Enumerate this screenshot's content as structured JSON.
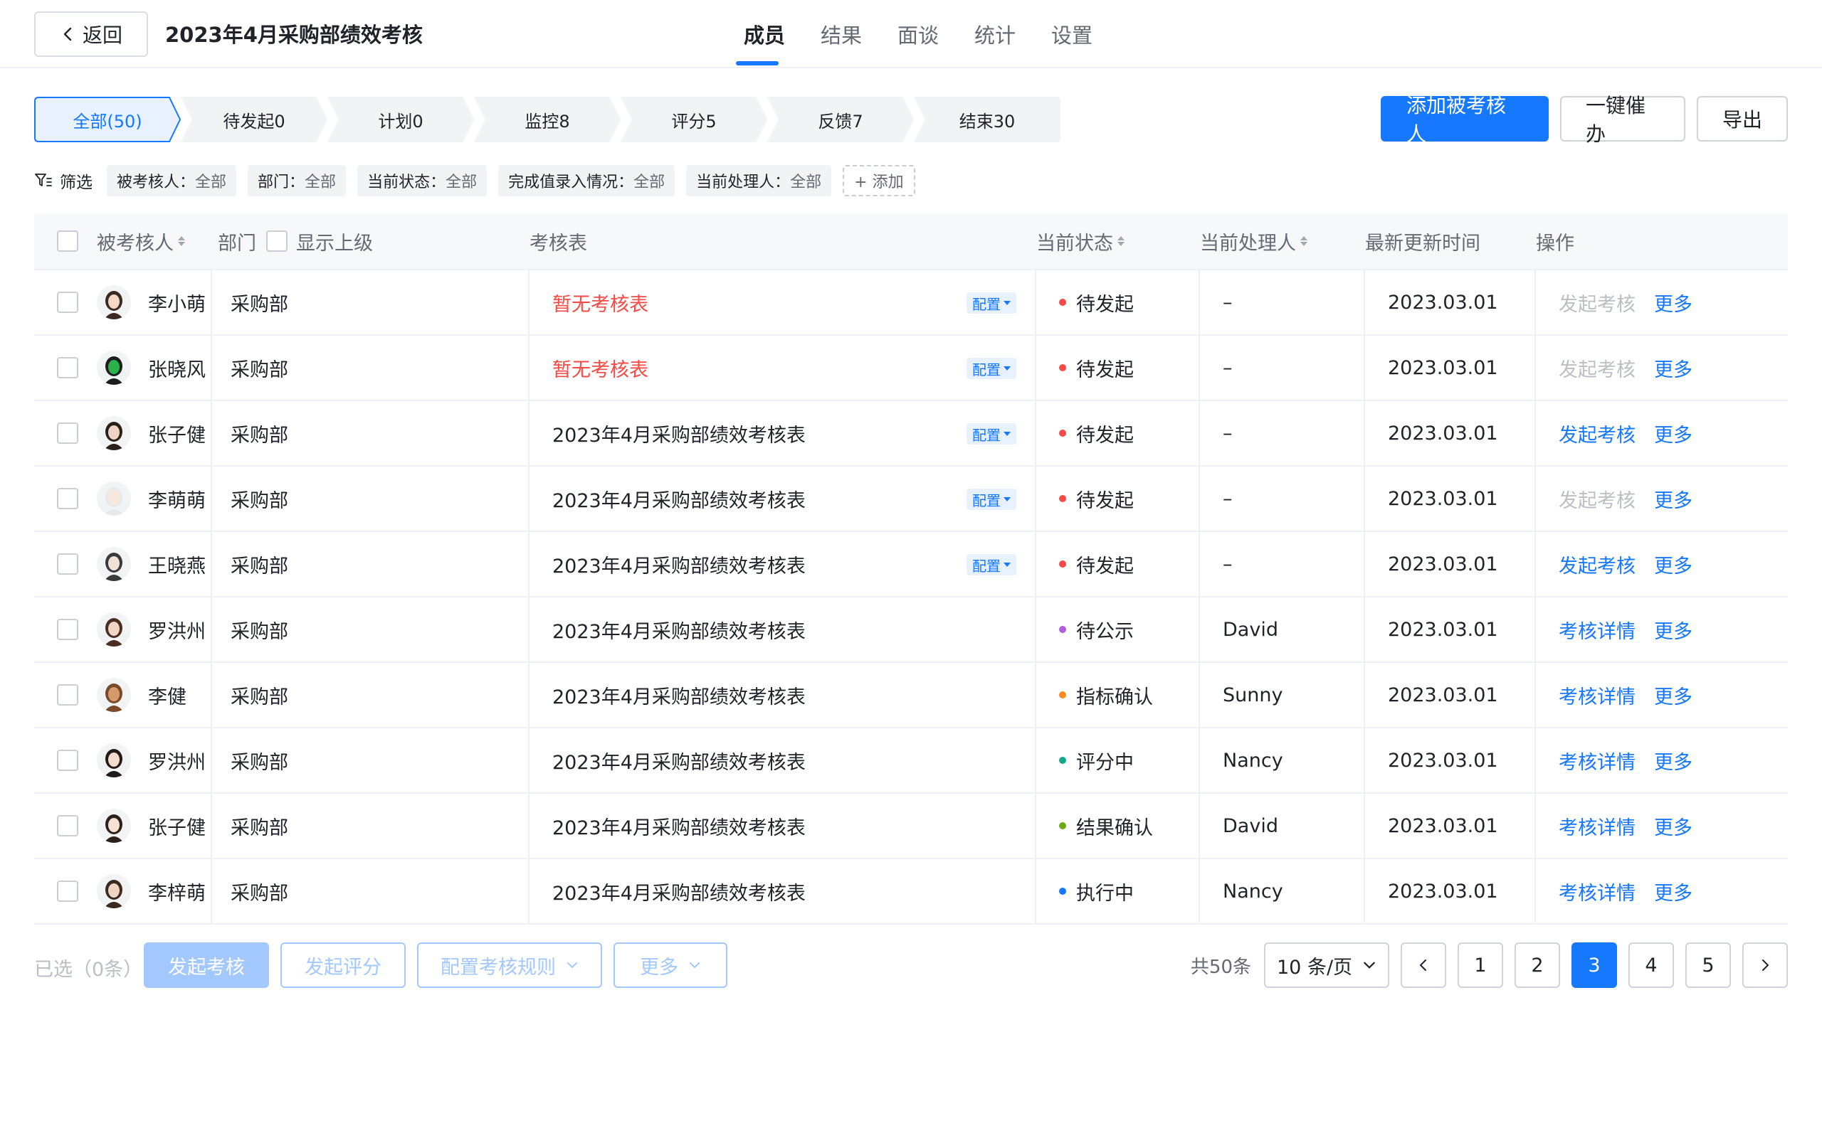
{
  "header": {
    "back_label": "返回",
    "title": "2023年4月采购部绩效考核",
    "tabs": [
      {
        "label": "成员"
      },
      {
        "label": "结果"
      },
      {
        "label": "面谈"
      },
      {
        "label": "统计"
      },
      {
        "label": "设置"
      }
    ],
    "active_tab": 0
  },
  "steps": [
    {
      "label": "全部(50)"
    },
    {
      "label": "待发起0"
    },
    {
      "label": "计划0"
    },
    {
      "label": "监控8"
    },
    {
      "label": "评分5"
    },
    {
      "label": "反馈7"
    },
    {
      "label": "结束30"
    }
  ],
  "actions": {
    "add_label": "添加被考核人",
    "urge_label": "一键催办",
    "export_label": "导出"
  },
  "filters": {
    "label": "筛选",
    "chips": [
      {
        "key": "被考核人：",
        "value": "全部"
      },
      {
        "key": "部门：",
        "value": "全部"
      },
      {
        "key": "当前状态：",
        "value": "全部"
      },
      {
        "key": "完成值录入情况：",
        "value": "全部"
      },
      {
        "key": "当前处理人：",
        "value": "全部"
      }
    ],
    "add_label": "+ 添加"
  },
  "table": {
    "headers": {
      "name": "被考核人",
      "dept": "部门",
      "show_parent": "显示上级",
      "form": "考核表",
      "status": "当前状态",
      "handler": "当前处理人",
      "time": "最新更新时间",
      "ops": "操作"
    },
    "config_label": "配置",
    "more_label": "更多",
    "rows": [
      {
        "name": "李小萌",
        "dept": "采购部",
        "form": "暂无考核表",
        "status": "待发起",
        "handler": "–",
        "time": "2023.03.01",
        "op": "发起考核"
      },
      {
        "name": "张晓风",
        "dept": "采购部",
        "form": "暂无考核表",
        "status": "待发起",
        "handler": "–",
        "time": "2023.03.01",
        "op": "发起考核"
      },
      {
        "name": "张子健",
        "dept": "采购部",
        "form": "2023年4月采购部绩效考核表",
        "status": "待发起",
        "handler": "–",
        "time": "2023.03.01",
        "op": "发起考核"
      },
      {
        "name": "李萌萌",
        "dept": "采购部",
        "form": "2023年4月采购部绩效考核表",
        "status": "待发起",
        "handler": "–",
        "time": "2023.03.01",
        "op": "发起考核"
      },
      {
        "name": "王晓燕",
        "dept": "采购部",
        "form": "2023年4月采购部绩效考核表",
        "status": "待发起",
        "handler": "–",
        "time": "2023.03.01",
        "op": "发起考核"
      },
      {
        "name": "罗洪州",
        "dept": "采购部",
        "form": "2023年4月采购部绩效考核表",
        "status": "待公示",
        "handler": "David",
        "time": "2023.03.01",
        "op": "考核详情"
      },
      {
        "name": "李健",
        "dept": "采购部",
        "form": "2023年4月采购部绩效考核表",
        "status": "指标确认",
        "handler": "Sunny",
        "time": "2023.03.01",
        "op": "考核详情"
      },
      {
        "name": "罗洪州",
        "dept": "采购部",
        "form": "2023年4月采购部绩效考核表",
        "status": "评分中",
        "handler": "Nancy",
        "time": "2023.03.01",
        "op": "考核详情"
      },
      {
        "name": "张子健",
        "dept": "采购部",
        "form": "2023年4月采购部绩效考核表",
        "status": "结果确认",
        "handler": "David",
        "time": "2023.03.01",
        "op": "考核详情"
      },
      {
        "name": "李梓萌",
        "dept": "采购部",
        "form": "2023年4月采购部绩效考核表",
        "status": "执行中",
        "handler": "Nancy",
        "time": "2023.03.01",
        "op": "考核详情"
      }
    ]
  },
  "footer": {
    "selected": "已选（0条）",
    "start_review": "发起考核",
    "start_score": "发起评分",
    "config_rules": "配置考核规则",
    "more": "更多",
    "total": "共50条",
    "page_size": "10 条/页",
    "pages": [
      "1",
      "2",
      "3",
      "4",
      "5"
    ],
    "current_page": "3"
  },
  "colors": {
    "primary": "#1677ff",
    "danger": "#f54a45",
    "status_pending": "#f54a45",
    "status_publish": "#b05de0",
    "status_confirm": "#ff8a1f",
    "status_scoring": "#14a88a",
    "status_result": "#6ea815",
    "status_running": "#1677ff"
  }
}
